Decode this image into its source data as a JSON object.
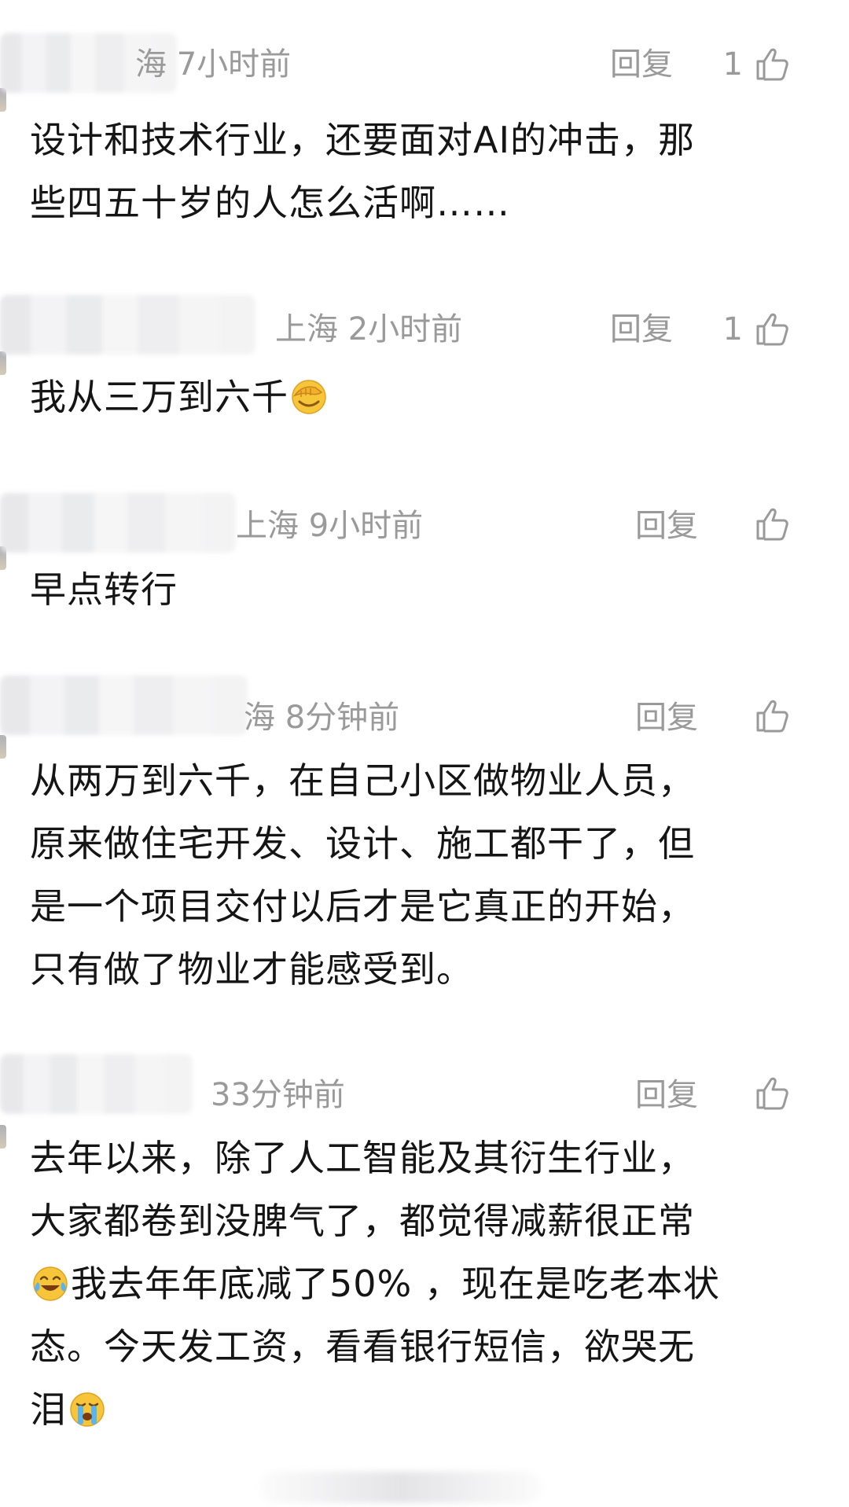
{
  "comments": [
    {
      "location_time": "海  7小时前",
      "reply_label": "回复",
      "like_count": "1",
      "text_lines": [
        "设计和技术行业，还要面对AI的冲击，那",
        "些四五十岁的人怎么活啊……"
      ]
    },
    {
      "location_time": "上海  2小时前",
      "reply_label": "回复",
      "like_count": "1",
      "text_before_emoji": "我从三万到六千",
      "emoji": "facepalm-emoji"
    },
    {
      "location_time": "上海  9小时前",
      "reply_label": "回复",
      "like_count": "",
      "text": "早点转行"
    },
    {
      "location_time": "海  8分钟前",
      "reply_label": "回复",
      "like_count": "",
      "text_lines": [
        "从两万到六千，在自己小区做物业人员，",
        "原来做住宅开发、设计、施工都干了，但",
        "是一个项目交付以后才是它真正的开始，",
        "只有做了物业才能感受到。"
      ]
    },
    {
      "location_time": "33分钟前",
      "reply_label": "回复",
      "like_count": "",
      "line1": "去年以来，除了人工智能及其衍生行业，",
      "line2": "大家都卷到没脾气了，都觉得减薪很正常",
      "line3_after_emoji": "我去年年底减了50% ，现在是吃老本状",
      "line4": "态。今天发工资，看看银行短信，欲哭无",
      "line5_before_emoji": "泪",
      "emoji_a": "laughing-tears-emoji",
      "emoji_b": "crying-emoji"
    }
  ],
  "colors": {
    "meta_gray": "#9a9a9a",
    "text": "#151515",
    "background": "#ffffff"
  }
}
